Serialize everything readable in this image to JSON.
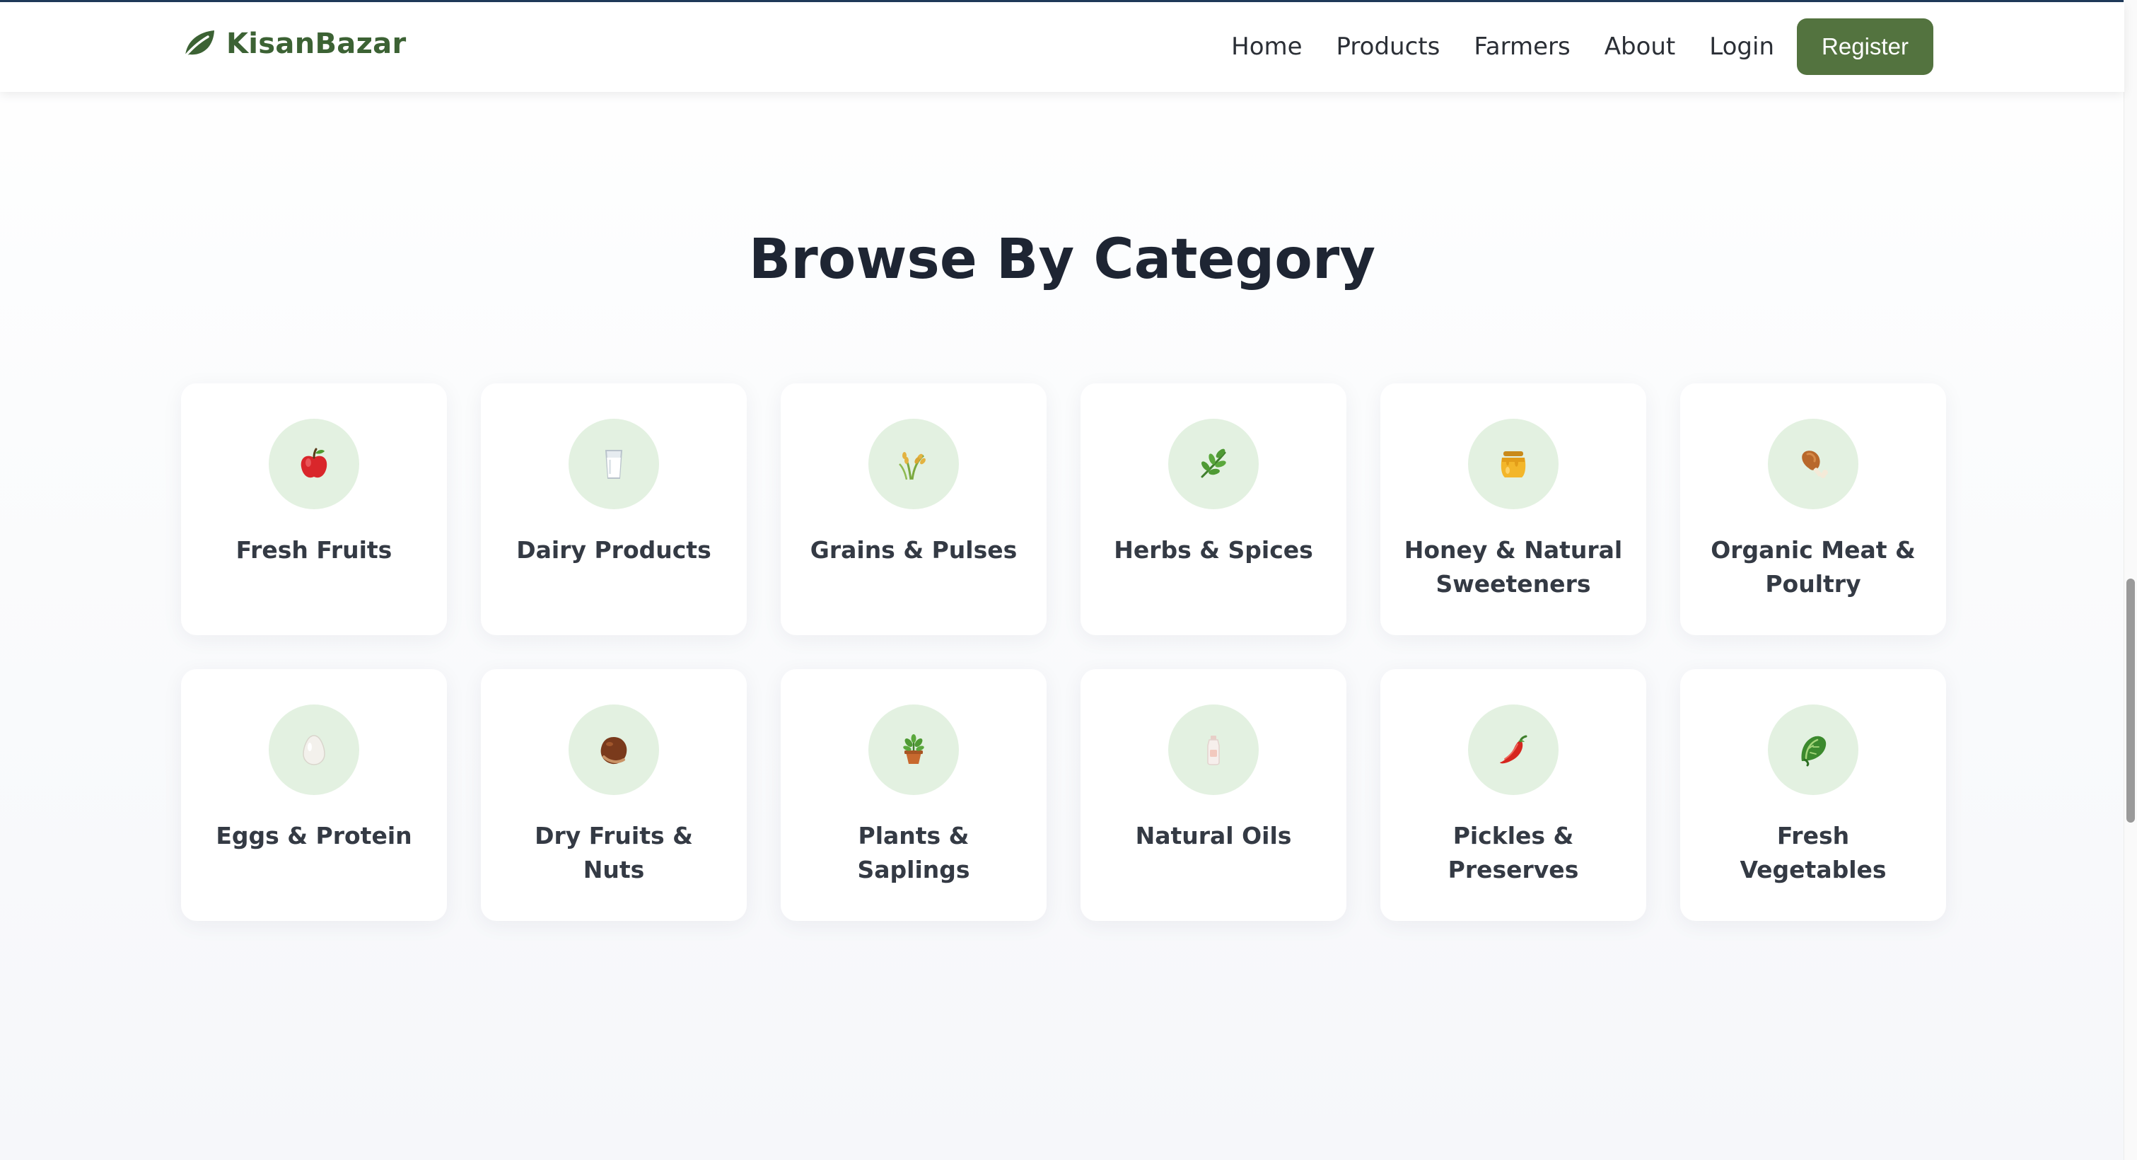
{
  "navbar": {
    "brand": "KisanBazar",
    "links": [
      "Home",
      "Products",
      "Farmers",
      "About",
      "Login"
    ],
    "register_label": "Register"
  },
  "section": {
    "title": "Browse By Category"
  },
  "categories": [
    {
      "label": "Fresh Fruits",
      "icon": "apple-icon"
    },
    {
      "label": "Dairy Products",
      "icon": "milk-glass-icon"
    },
    {
      "label": "Grains & Pulses",
      "icon": "rice-sheaf-icon"
    },
    {
      "label": "Herbs & Spices",
      "icon": "herb-icon"
    },
    {
      "label": "Honey & Natural Sweeteners",
      "icon": "honey-pot-icon"
    },
    {
      "label": "Organic Meat & Poultry",
      "icon": "poultry-leg-icon"
    },
    {
      "label": "Eggs & Protein",
      "icon": "egg-icon"
    },
    {
      "label": "Dry Fruits & Nuts",
      "icon": "chestnut-icon"
    },
    {
      "label": "Plants & Saplings",
      "icon": "potted-plant-icon"
    },
    {
      "label": "Natural Oils",
      "icon": "oil-bottle-icon"
    },
    {
      "label": "Pickles & Preserves",
      "icon": "chili-pepper-icon"
    },
    {
      "label": "Fresh Vegetables",
      "icon": "leafy-green-icon"
    }
  ],
  "colors": {
    "brand_green": "#3c6234",
    "button_green": "#53733f",
    "icon_circle_bg": "#e3f1e1",
    "heading": "#1e2533"
  }
}
